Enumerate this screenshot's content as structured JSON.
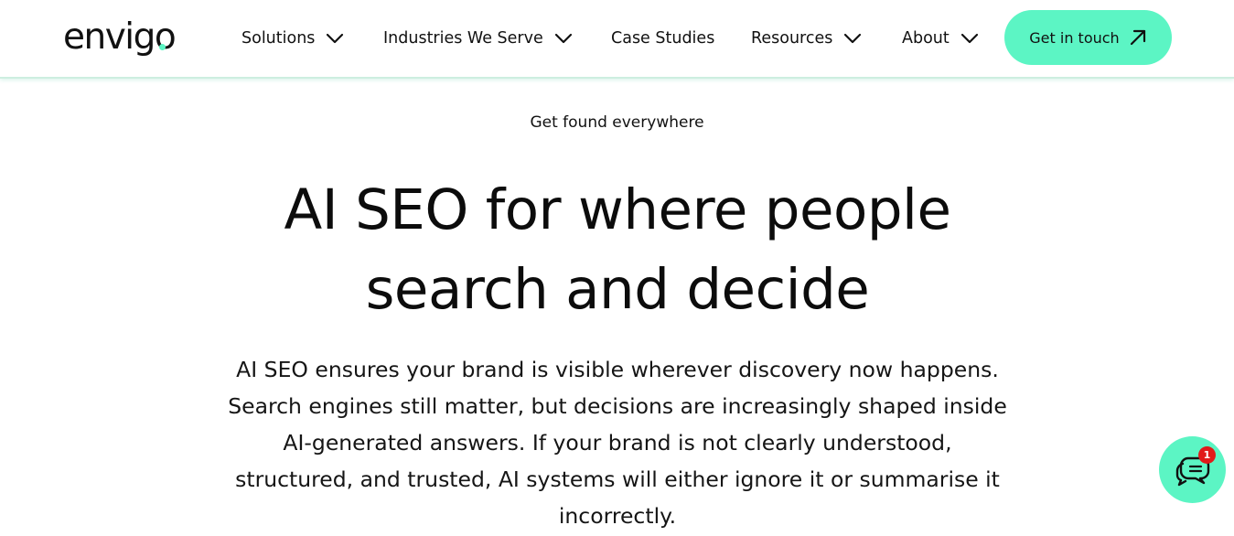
{
  "colors": {
    "accent": "#5cf5c4",
    "badge": "#e11a1a",
    "text": "#111111"
  },
  "header": {
    "logo_text": "envigo",
    "nav": [
      {
        "label": "Solutions",
        "has_dropdown": true,
        "icon": "chevron-down-icon"
      },
      {
        "label": "Industries We Serve",
        "has_dropdown": true,
        "icon": "chevron-down-icon"
      },
      {
        "label": "Case Studies",
        "has_dropdown": false
      },
      {
        "label": "Resources",
        "has_dropdown": true,
        "icon": "chevron-down-icon"
      },
      {
        "label": "About",
        "has_dropdown": true,
        "icon": "chevron-down-icon"
      }
    ],
    "cta_label": "Get in touch",
    "cta_icon": "arrow-up-right-icon"
  },
  "hero": {
    "eyebrow": "Get found everywhere",
    "headline_line1": "AI SEO for where people",
    "headline_line2": "search and decide",
    "body_line1": "AI SEO ensures your brand is visible wherever discovery now happens.",
    "body_line2": "Search engines still matter, but decisions are increasingly shaped inside",
    "body_line3": "AI-generated answers. If your brand is not clearly understood,",
    "body_line4": "structured, and trusted, AI systems will either ignore it or summarise it",
    "body_line5": "incorrectly."
  },
  "chat_widget": {
    "icon": "chat-bubbles-icon",
    "badge_count": "1"
  }
}
